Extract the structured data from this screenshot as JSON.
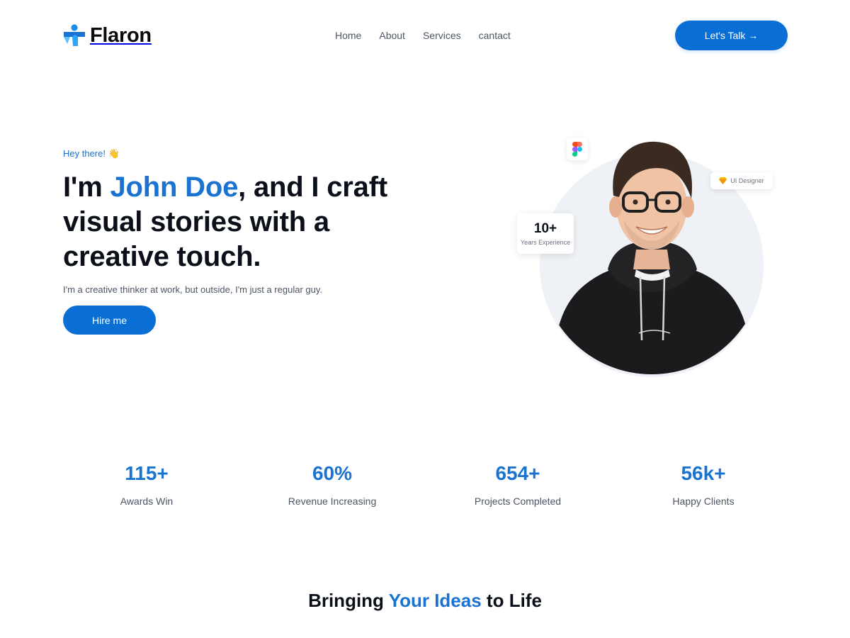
{
  "brand": {
    "name": "Flaron",
    "accent_color": "#1a73d1",
    "button_color": "#0a6fd4"
  },
  "nav": {
    "items": [
      {
        "label": "Home"
      },
      {
        "label": "About"
      },
      {
        "label": "Services"
      },
      {
        "label": "cantact"
      }
    ],
    "cta_label": "Let's Talk →"
  },
  "hero": {
    "greeting": "Hey there! 👋",
    "title_prefix": "I'm ",
    "title_name": "John Doe",
    "title_suffix": ", and I craft visual stories with a creative touch.",
    "subtitle": "I'm a creative thinker at work, but outside, I'm just a regular guy.",
    "button_label": "Hire me"
  },
  "portrait": {
    "figma_icon": "figma-icon",
    "role_icon": "diamond-icon",
    "role_label": "UI Designer",
    "experience_value": "10+",
    "experience_label": "Years Experience"
  },
  "stats": [
    {
      "value": "115+",
      "label": "Awards Win"
    },
    {
      "value": "60%",
      "label": "Revenue Increasing"
    },
    {
      "value": "654+",
      "label": "Projects Completed"
    },
    {
      "value": "56k+",
      "label": "Happy Clients"
    }
  ],
  "section": {
    "title_prefix": "Bringing ",
    "title_accent": "Your Ideas",
    "title_suffix": " to Life"
  }
}
